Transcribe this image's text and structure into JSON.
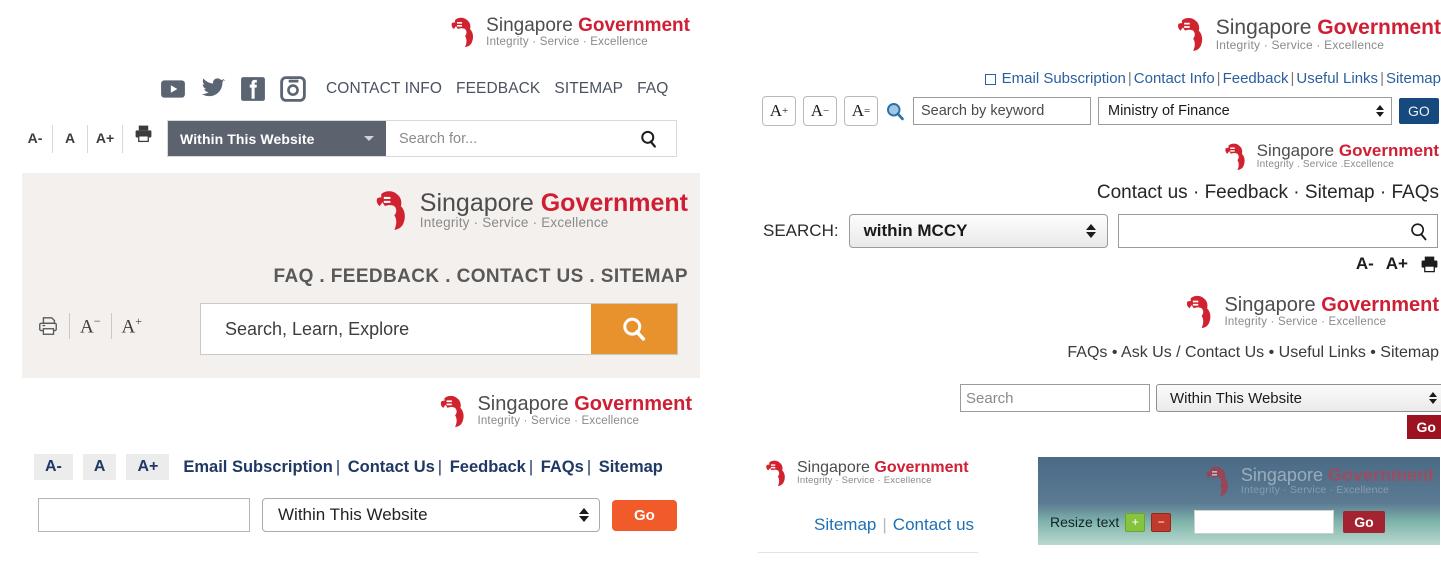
{
  "brand": {
    "line1_part1": "Singapore ",
    "line1_part2": "Government",
    "tagline": "Integrity · Service · Excellence",
    "tagline_mccy": "Integrity . Service .Excellence",
    "lion_icon": "singapore-lion-crest-icon",
    "red": "#cf1f35",
    "gray": "#8a8a8a"
  },
  "panel1": {
    "social": [
      {
        "name": "youtube-icon",
        "label": "YouTube"
      },
      {
        "name": "twitter-icon",
        "label": "Twitter"
      },
      {
        "name": "facebook-icon",
        "label": "Facebook"
      },
      {
        "name": "instagram-icon",
        "label": "Instagram"
      }
    ],
    "links": [
      "CONTACT INFO",
      "FEEDBACK",
      "SITEMAP",
      "FAQ"
    ],
    "font_smaller": "A-",
    "font_normal": "A",
    "font_larger": "A+",
    "print_icon": "printer-icon",
    "scope_value": "Within This Website",
    "search_placeholder": "Search for...",
    "search_icon": "magnifier-icon",
    "bar_color": "#5c636e"
  },
  "panel2": {
    "nav": "FAQ . FEEDBACK . CONTACT US . SITEMAP",
    "print_icon": "printer-icon",
    "font_smaller": "A",
    "font_smaller_sup": "−",
    "font_larger": "A",
    "font_larger_sup": "+",
    "search_placeholder": "Search, Learn, Explore",
    "search_icon": "magnifier-icon",
    "go_color": "#e8922e",
    "bg_color": "#f4f0ed"
  },
  "panel3": {
    "font_smaller": "A-",
    "font_normal": "A",
    "font_larger": "A+",
    "links": [
      "Email Subscription",
      "Contact Us",
      "Feedback",
      "FAQs",
      "Sitemap"
    ],
    "separator": "|",
    "search_value": "",
    "scope_value": "Within This Website",
    "go_label": "Go",
    "go_color": "#f15a29",
    "link_color": "#1f3864"
  },
  "panel4": {
    "checkbox_icon": "checkbox-unchecked-icon",
    "links": [
      "Email Subscription",
      "Contact Info",
      "Feedback",
      "Useful Links",
      "Sitemap"
    ],
    "separator": "|",
    "font_larger": "A",
    "font_larger_sup": "+",
    "font_smaller": "A",
    "font_smaller_sup": "−",
    "font_reset": "A",
    "font_reset_sup": "=",
    "search_icon": "magnifier-icon",
    "search_placeholder": "Search by keyword",
    "scope_value": "Ministry of Finance",
    "go_label": "GO",
    "go_color": "#16497d",
    "link_color": "#2b5f9e"
  },
  "panel5": {
    "nav": "Contact us · Feedback · Sitemap · FAQs",
    "search_label": "SEARCH:",
    "scope_value": "within MCCY",
    "search_value": "",
    "search_icon": "magnifier-icon",
    "font_smaller": "A-",
    "font_larger": "A+",
    "print_icon": "printer-icon"
  },
  "panel6": {
    "nav": "FAQs • Ask Us / Contact Us • Useful Links • Sitemap",
    "search_placeholder": "Search",
    "scope_value": "Within This Website",
    "go_label": "Go",
    "go_color": "#9b1220"
  },
  "panel7": {
    "links": [
      "Sitemap",
      "Contact us"
    ],
    "separator": "|",
    "link_color": "#1f6fb5"
  },
  "panel8": {
    "resize_label": "Resize text",
    "increase_label": "+",
    "decrease_label": "−",
    "search_value": "",
    "go_label": "Go",
    "go_color": "#a32430"
  }
}
